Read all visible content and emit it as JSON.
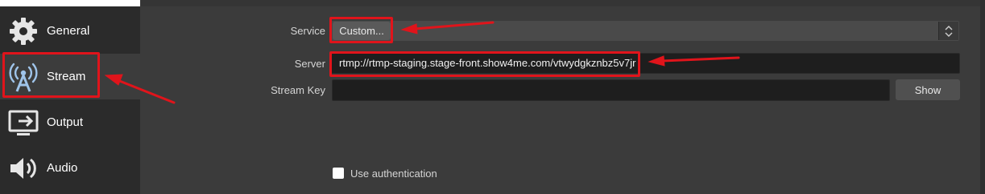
{
  "sidebar": {
    "items": [
      {
        "label": "General",
        "icon": "gear-icon"
      },
      {
        "label": "Stream",
        "icon": "broadcast-tower-icon"
      },
      {
        "label": "Output",
        "icon": "output-monitor-icon"
      },
      {
        "label": "Audio",
        "icon": "speaker-icon"
      }
    ],
    "selected": "Stream"
  },
  "form": {
    "service_label": "Service",
    "service_value": "Custom...",
    "server_label": "Server",
    "server_value": "rtmp://rtmp-staging.stage-front.show4me.com/vtwydgkznbz5v7jr",
    "stream_key_label": "Stream Key",
    "stream_key_value": "",
    "show_button": "Show",
    "use_auth_label": "Use authentication",
    "use_auth_checked": false
  },
  "colors": {
    "annotation_red": "#e0141b",
    "sidebar_bg": "#2b2b2b",
    "main_bg": "#3b3b3b"
  }
}
